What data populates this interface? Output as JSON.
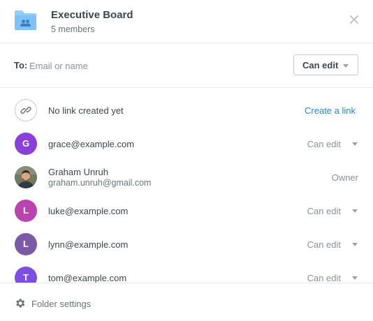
{
  "header": {
    "title": "Executive Board",
    "subtitle": "5 members",
    "folder_icon": "shared-folder-icon",
    "close_icon": "close-icon"
  },
  "share": {
    "to_label": "To:",
    "placeholder": "Email or name",
    "permission_label": "Can edit"
  },
  "link": {
    "status": "No link created yet",
    "action": "Create a link",
    "icon": "link-icon"
  },
  "members": [
    {
      "initial": "G",
      "email": "grace@example.com",
      "permission": "Can edit",
      "color": "#8b3fd9"
    },
    {
      "name": "Graham Unruh",
      "email": "graham.unruh@gmail.com",
      "permission": "Owner",
      "photo": true
    },
    {
      "initial": "L",
      "email": "luke@example.com",
      "permission": "Can edit",
      "color": "#b944b0"
    },
    {
      "initial": "L",
      "email": "lynn@example.com",
      "permission": "Can edit",
      "color": "#7a5aa6"
    },
    {
      "initial": "T",
      "email": "tom@example.com",
      "permission": "Can edit",
      "color": "#7c4fe0"
    }
  ],
  "footer": {
    "label": "Folder settings",
    "icon": "gear-icon"
  },
  "colors": {
    "link_blue": "#2d84c4",
    "folder_blue": "#92ceff",
    "divider": "#e6e8eb"
  }
}
